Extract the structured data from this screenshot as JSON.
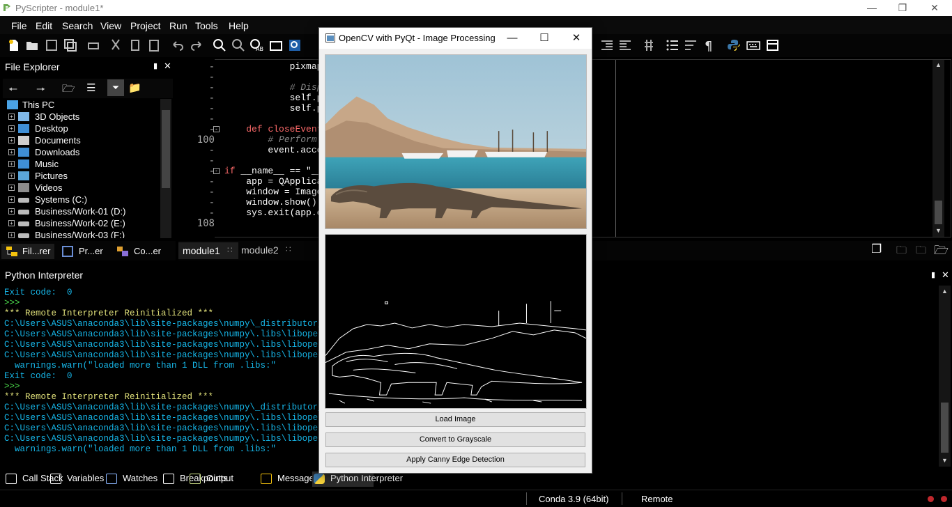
{
  "window": {
    "title": "PyScripter - module1*"
  },
  "menu": [
    "File",
    "Edit",
    "Search",
    "View",
    "Project",
    "Run",
    "Tools",
    "Help"
  ],
  "file_explorer": {
    "title": "File Explorer",
    "tree": [
      {
        "label": "This PC",
        "icon": "computer-icon",
        "root": true
      },
      {
        "label": "3D Objects",
        "icon": "3d-objects-icon"
      },
      {
        "label": "Desktop",
        "icon": "desktop-icon"
      },
      {
        "label": "Documents",
        "icon": "documents-icon"
      },
      {
        "label": "Downloads",
        "icon": "downloads-icon"
      },
      {
        "label": "Music",
        "icon": "music-icon"
      },
      {
        "label": "Pictures",
        "icon": "pictures-icon"
      },
      {
        "label": "Videos",
        "icon": "videos-icon"
      },
      {
        "label": "Systems (C:)",
        "icon": "drive-icon"
      },
      {
        "label": "Business/Work-01 (D:)",
        "icon": "drive-icon"
      },
      {
        "label": "Business/Work-02 (E:)",
        "icon": "drive-icon"
      },
      {
        "label": "Business/Work-03 (F:)",
        "icon": "drive-icon"
      }
    ],
    "tabs": [
      "Fil...rer",
      "Pr...er",
      "Co...er"
    ]
  },
  "editor": {
    "line_numbers": [
      "-",
      "-",
      "-",
      "-",
      "-",
      "-",
      "-",
      "100",
      "-",
      "-",
      "-",
      "-",
      "-",
      "-",
      "-",
      "108"
    ],
    "lines": [
      {
        "indent": "            ",
        "parts": [
          {
            "t": "pixmap",
            "c": ""
          }
        ]
      },
      {
        "indent": "",
        "parts": []
      },
      {
        "indent": "            ",
        "parts": [
          {
            "t": "# Displ",
            "c": "cm"
          }
        ]
      },
      {
        "indent": "            ",
        "parts": [
          {
            "t": "self.pr",
            "c": ""
          }
        ]
      },
      {
        "indent": "            ",
        "parts": [
          {
            "t": "self.pr",
            "c": ""
          }
        ]
      },
      {
        "indent": "",
        "parts": []
      },
      {
        "indent": "    ",
        "parts": [
          {
            "t": "def ",
            "c": "kw"
          },
          {
            "t": "closeEvent(",
            "c": "kw"
          }
        ]
      },
      {
        "indent": "        ",
        "parts": [
          {
            "t": "# Perform c",
            "c": "cm"
          }
        ]
      },
      {
        "indent": "        ",
        "parts": [
          {
            "t": "event.accept",
            "c": ""
          }
        ]
      },
      {
        "indent": "",
        "parts": []
      },
      {
        "indent": "",
        "parts": [
          {
            "t": "if ",
            "c": "kw"
          },
          {
            "t": "__name__ == \"__m",
            "c": ""
          }
        ]
      },
      {
        "indent": "    ",
        "parts": [
          {
            "t": "app = QApplicat",
            "c": ""
          }
        ]
      },
      {
        "indent": "    ",
        "parts": [
          {
            "t": "window = ImageP",
            "c": ""
          }
        ]
      },
      {
        "indent": "    ",
        "parts": [
          {
            "t": "window.show()",
            "c": ""
          }
        ]
      },
      {
        "indent": "    ",
        "parts": [
          {
            "t": "sys.exit(app.ex",
            "c": ""
          }
        ]
      },
      {
        "indent": "",
        "parts": []
      }
    ],
    "tabs": [
      "module1",
      "module2"
    ]
  },
  "interpreter": {
    "title": "Python Interpreter",
    "lines": [
      {
        "text": "Exit code:  0",
        "c": "cy"
      },
      {
        "text": ">>>",
        "c": "gr"
      },
      {
        "text": "*** Remote Interpreter Reinitialized ***",
        "c": "ye"
      },
      {
        "text": "C:\\Users\\ASUS\\anaconda3\\lib\\site-packages\\numpy\\_distributor_init",
        "c": "cy"
      },
      {
        "text": "C:\\Users\\ASUS\\anaconda3\\lib\\site-packages\\numpy\\.libs\\libopenblas",
        "c": "cy"
      },
      {
        "text": "C:\\Users\\ASUS\\anaconda3\\lib\\site-packages\\numpy\\.libs\\libopenblas",
        "c": "cy"
      },
      {
        "text": "C:\\Users\\ASUS\\anaconda3\\lib\\site-packages\\numpy\\.libs\\libopenblas",
        "c": "cy"
      },
      {
        "text": "  warnings.warn(\"loaded more than 1 DLL from .libs:\"",
        "c": "cy"
      },
      {
        "text": "Exit code:  0",
        "c": "cy"
      },
      {
        "text": ">>>",
        "c": "gr"
      },
      {
        "text": "*** Remote Interpreter Reinitialized ***",
        "c": "ye"
      },
      {
        "text": "C:\\Users\\ASUS\\anaconda3\\lib\\site-packages\\numpy\\_distributor_init",
        "c": "cy"
      },
      {
        "text": "C:\\Users\\ASUS\\anaconda3\\lib\\site-packages\\numpy\\.libs\\libopenblas",
        "c": "cy"
      },
      {
        "text": "C:\\Users\\ASUS\\anaconda3\\lib\\site-packages\\numpy\\.libs\\libopenblas",
        "c": "cy"
      },
      {
        "text": "C:\\Users\\ASUS\\anaconda3\\lib\\site-packages\\numpy\\.libs\\libopenblas",
        "c": "cy"
      },
      {
        "text": "  warnings.warn(\"loaded more than 1 DLL from .libs:\"",
        "c": "cy"
      }
    ]
  },
  "bottom_tabs": [
    {
      "label": "Call Stack",
      "icon": "call-stack-icon"
    },
    {
      "label": "Variables",
      "icon": "variables-icon"
    },
    {
      "label": "Watches",
      "icon": "watches-icon"
    },
    {
      "label": "Breakpoints",
      "icon": "breakpoints-icon"
    },
    {
      "label": "Output",
      "icon": "output-icon"
    },
    {
      "label": "Messages",
      "icon": "messages-icon"
    },
    {
      "label": "Python Interpreter",
      "icon": "python-icon"
    }
  ],
  "status": {
    "env": "Conda 3.9 (64bit)",
    "mode": "Remote"
  },
  "qt_window": {
    "title": "OpenCV with PyQt - Image Processing",
    "buttons": [
      "Load Image",
      "Convert to Grayscale",
      "Apply Canny Edge Detection"
    ]
  }
}
